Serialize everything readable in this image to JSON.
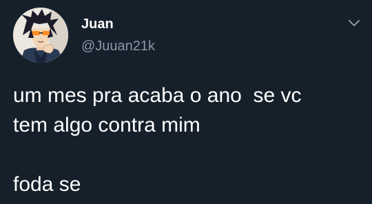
{
  "author": {
    "display_name": "Juan",
    "handle": "@Juuan21k",
    "avatar_icon": "anime-character-avatar-icon"
  },
  "menu": {
    "icon": "chevron-down-icon"
  },
  "tweet": {
    "line1": "um mes pra acaba o ano  se vc",
    "line2": "tem algo contra mim",
    "line3": "",
    "line4": "foda se"
  },
  "colors": {
    "background": "#15202b",
    "text_primary": "#ffffff",
    "text_secondary": "#8899a6"
  }
}
